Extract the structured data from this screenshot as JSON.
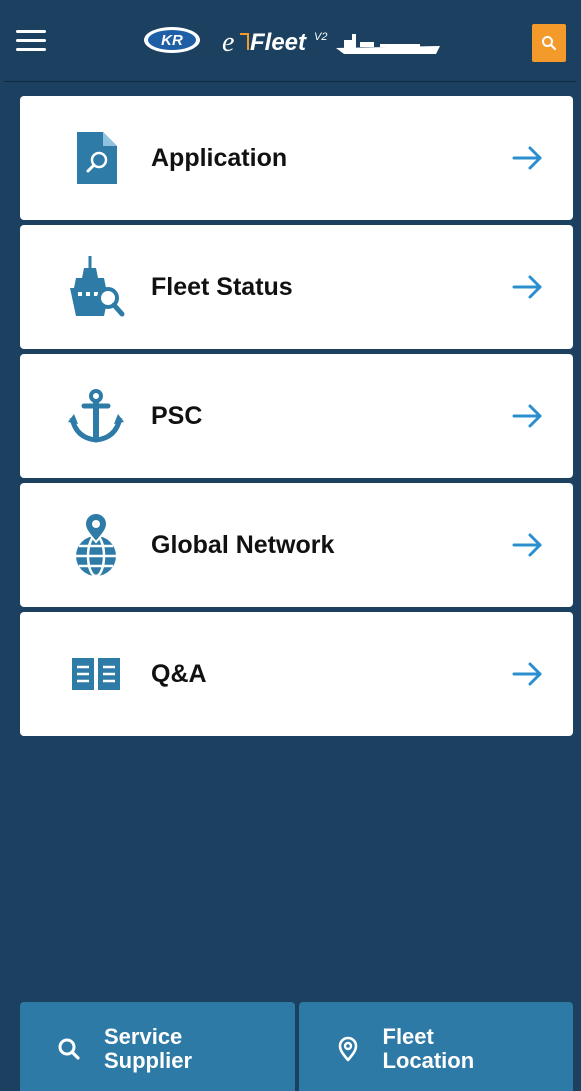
{
  "header": {
    "logo_badge": "KR",
    "logo_prefix": "e",
    "logo_name": "Fleet",
    "logo_version": "V2",
    "menu_icon": "hamburger-icon",
    "search_icon": "search-icon",
    "accent": "#f39a2b"
  },
  "menu": {
    "items": [
      {
        "label": "Application",
        "icon": "document-search-icon"
      },
      {
        "label": "Fleet Status",
        "icon": "ship-search-icon"
      },
      {
        "label": "PSC",
        "icon": "anchor-icon"
      },
      {
        "label": "Global Network",
        "icon": "globe-pin-icon"
      },
      {
        "label": "Q&A",
        "icon": "book-icon"
      }
    ],
    "arrow_color": "#2b8fcf"
  },
  "bottom_bar": {
    "service_supplier": "Service\nSupplier",
    "fleet_location": "Fleet\nLocation"
  },
  "colors": {
    "background": "#1c4160",
    "icon_blue": "#2d7ba6",
    "bottom_button": "#2e7aa6"
  }
}
